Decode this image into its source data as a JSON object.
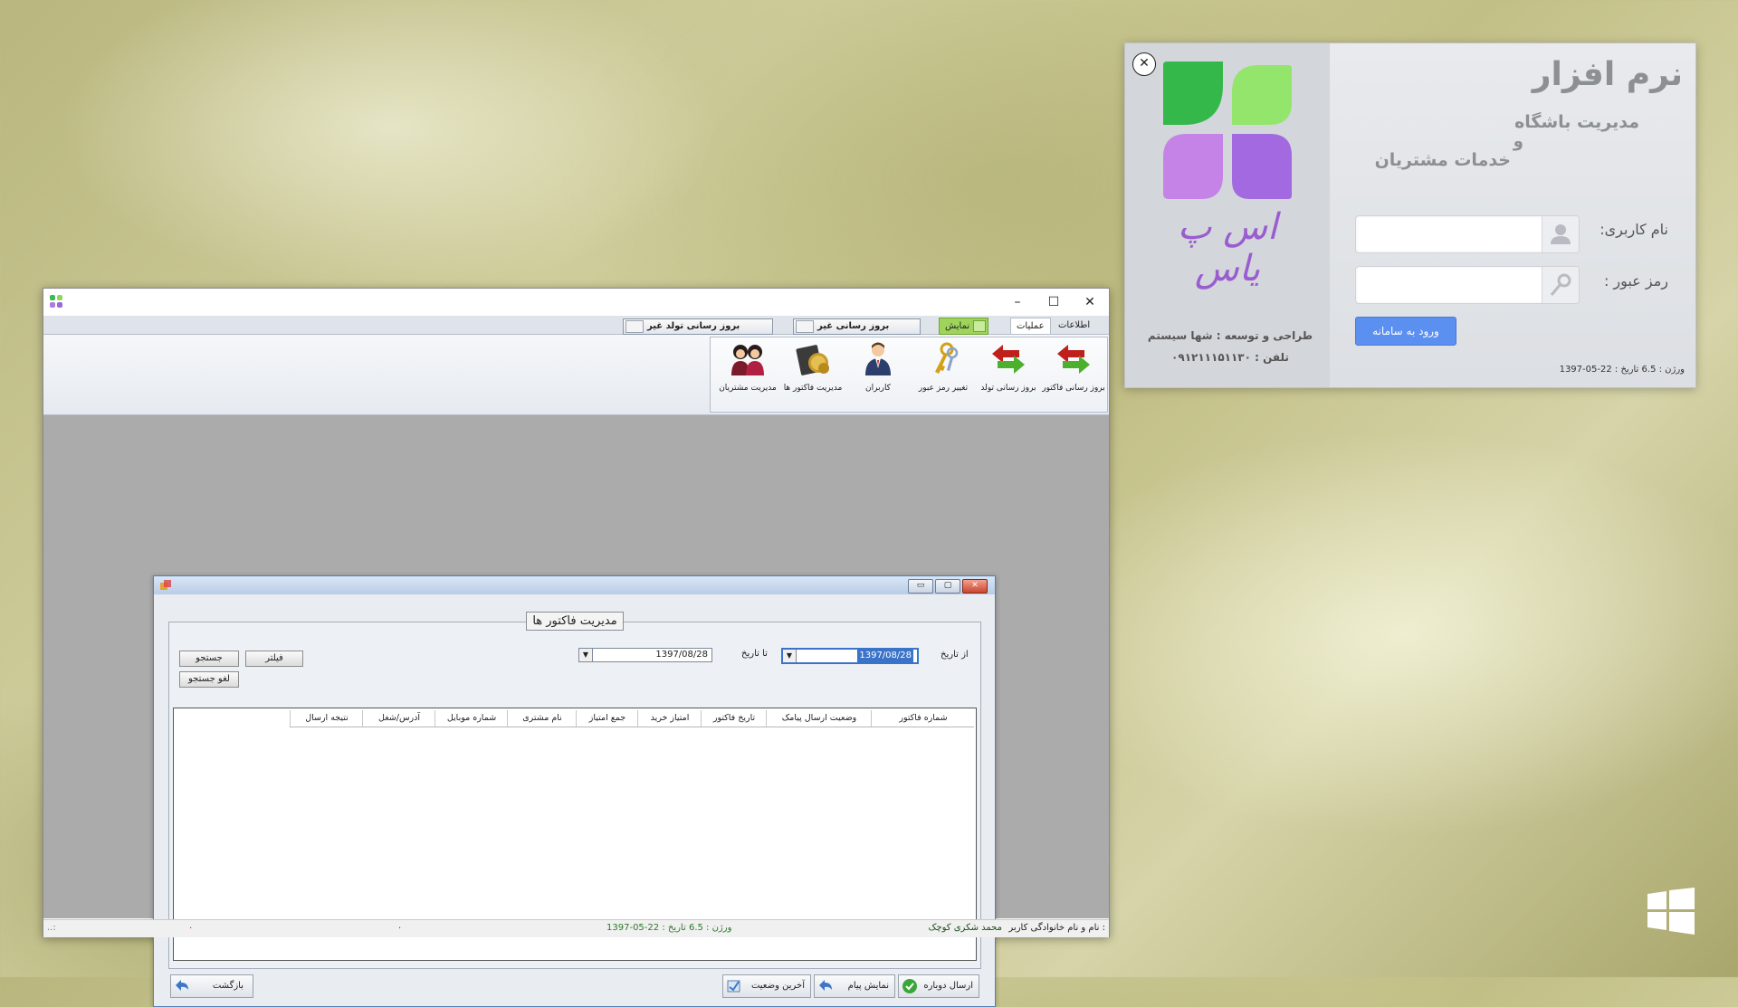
{
  "main_window": {
    "titlebar": {
      "minimize": "–",
      "maximize": "☐",
      "close": "✕"
    },
    "ribbon_tabs": [
      "اطلاعات پایه",
      "عملیات",
      "نمایش"
    ],
    "quick_buttons": [
      "بروز رسانی غیر خودکار",
      "بروز رسانی تولد غیر خودکار"
    ],
    "ribbon_items": [
      {
        "label": "بروز رسانی فاکتور",
        "icon": "green-red-arrows-icon"
      },
      {
        "label": "بروز رسانی تولد",
        "icon": "green-red-arrows-icon"
      },
      {
        "label": "تغییر رمز عبور",
        "icon": "keys-icon"
      },
      {
        "label": "کاربران",
        "icon": "user-icon"
      },
      {
        "label": "مدیریت فاکتور ها",
        "icon": "coins-icon"
      },
      {
        "label": "مدیریت مشتریان",
        "icon": "customers-icon"
      }
    ],
    "status": {
      "user_label": "نام و نام خانوادگی کاربر :",
      "user_name": "محمد شکری کوچک",
      "version": "ورژن : 6.5 تاریخ : 22-05-1397",
      "grip": "..:",
      "dot1": ".",
      "dot2": "."
    }
  },
  "invoice_dialog": {
    "titlebar": {
      "minimize": "▭",
      "maximize": "▢",
      "close": "✕"
    },
    "group_title": "مدیریت فاکتور ها",
    "from_label": "از تاریخ",
    "from_date": "1397/08/28",
    "to_label": "تا تاریخ",
    "to_date": "1397/08/28",
    "dropdown_arrow": "▼",
    "filter_button": "فیلتر",
    "search_button": "جستجو",
    "cancel_search_button": "لغو جستجو",
    "columns": [
      "شماره فاکتور",
      "وضعیت ارسال پیامک",
      "تاریخ فاکتور",
      "امتیاز خرید",
      "جمع امتیاز",
      "نام مشتری",
      "شماره موبایل",
      "آدرس/شغل",
      "نتیجه ارسال"
    ],
    "buttons": {
      "resend": "ارسال دوباره",
      "show_message": "نمایش پیام",
      "last_status": "آخرین وضعیت",
      "back": "بازگشت"
    }
  },
  "login": {
    "title": "نرم افزار",
    "subtitle1": "مدیریت باشگاه",
    "and": "و",
    "subtitle2": "خدمات مشتریان",
    "brand": "اس پ یاس",
    "username_label": "نام کاربری:",
    "password_label": "رمز عبور :",
    "login_button": "ورود به سامانه",
    "developer": "طراحی و توسعه : شها سیستم",
    "phone": "تلفن : ۰۹۱۲۱۱۱۵۱۱۳۰",
    "version": "ورژن : 6.5 تاریخ : 22-05-1397",
    "close": "✕"
  },
  "colors": {
    "accent": "#5b8ff0",
    "green_tab": "#9fd45c",
    "selection": "#3a73c8"
  }
}
